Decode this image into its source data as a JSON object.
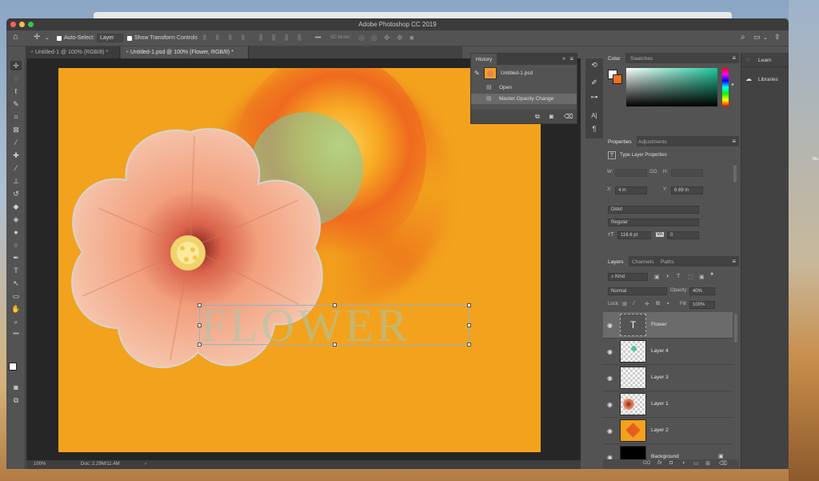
{
  "desktop": {
    "side_label_1": "",
    "side_label_2": "Ma"
  },
  "app": {
    "title": "Adobe Photoshop CC 2019"
  },
  "options_bar": {
    "auto_select_label": "Auto-Select:",
    "auto_select_value": "Layer",
    "show_transform_label": "Show Transform Controls",
    "mode_3d_label": "3D Mode:"
  },
  "tabs": [
    {
      "label": "Untitled-1 @ 100% (RGB/8) *"
    },
    {
      "label": "Untitled-1.psd @ 100% (Flower, RGB/8) *"
    }
  ],
  "canvas": {
    "text_layer_content": "FLOWER"
  },
  "status": {
    "zoom": "100%",
    "doc": "Doc: 2.29M/11.4M",
    "arrow": "›"
  },
  "history": {
    "tab_label": "History",
    "snapshot": "Untitled-1.psd",
    "items": [
      "Open",
      "Master Opacity Change"
    ]
  },
  "color_panel": {
    "tabs": [
      "Color",
      "Swatches"
    ],
    "foreground": "#ffffff",
    "background": "#f37021"
  },
  "properties": {
    "tabs": [
      "Properties",
      "Adjustments"
    ],
    "type_label": "Type Layer Properties",
    "w_label": "W:",
    "w_value": "",
    "go_label": "GO",
    "h_label": "H:",
    "h_value": "",
    "x_label": "X:",
    "x_value": "4 in",
    "y_label": "Y:",
    "y_value": "6.69 in",
    "font_family": "Didot",
    "font_style": "Regular",
    "font_size": "116.6 pt",
    "tracking": "0"
  },
  "layers_panel": {
    "tabs": [
      "Layers",
      "Channels",
      "Paths"
    ],
    "filter_kind": "Kind",
    "blend_mode": "Normal",
    "opacity_label": "Opacity:",
    "opacity_value": "40%",
    "lock_label": "Lock:",
    "fill_label": "Fill:",
    "fill_value": "100%",
    "layers": [
      {
        "name": "Flower",
        "type": "text"
      },
      {
        "name": "Layer 4",
        "type": "circle"
      },
      {
        "name": "Layer 3",
        "type": "empty"
      },
      {
        "name": "Layer 1",
        "type": "flower"
      },
      {
        "name": "Layer 2",
        "type": "orange"
      },
      {
        "name": "Background",
        "type": "black"
      }
    ],
    "footer_link_icon": "GO"
  },
  "libraries": {
    "learn": "Learn",
    "libraries": "Libraries"
  },
  "icons": {
    "home": "⌂",
    "move": "✛",
    "search": "⌕",
    "share": "⇪",
    "more": "•••",
    "eye": "◉",
    "lock": "☒",
    "trash": "☒"
  }
}
